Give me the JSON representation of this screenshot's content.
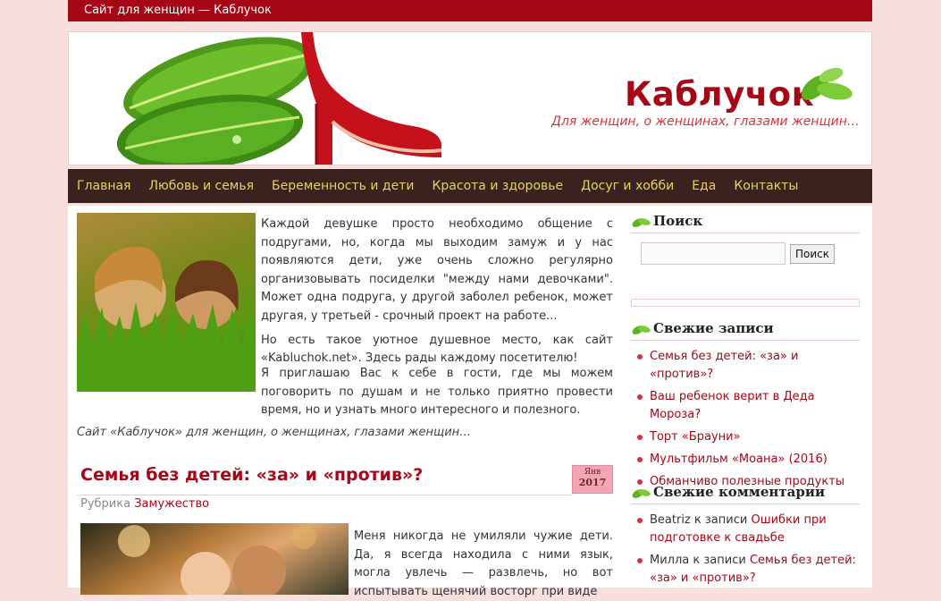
{
  "topbar": {
    "title": "Сайт для женщин — Каблучок"
  },
  "header": {
    "site_title": "Каблучок",
    "tagline": "Для женщин, о женщинах, глазами женщин…"
  },
  "nav": {
    "items": [
      "Главная",
      "Любовь и семья",
      "Беременность и дети",
      "Красота и здоровье",
      "Досуг и хобби",
      "Еда",
      "Контакты"
    ]
  },
  "intro": {
    "p1": "Каждой девушке просто необходимо общение с подругами, но, когда мы выходим замуж и у нас появляются дети, уже очень сложно регулярно организовывать посиделки \"между нами девочками\". Может одна подруга, у другой заболел ребенок, может другая, у третьей - срочный проект на работе...",
    "p2": "Но есть такое уютное душевное место, как сайт «Kabluchok.net». Здесь рады каждому посетителю!",
    "p3": "Я приглашаю Вас к себе в гости, где мы можем поговорить по душам и не только приятно провести время, но и узнать много интересного и полезного.",
    "signature": "Сайт «Каблучок» для женщин, о женщинах, глазами женщин…"
  },
  "post": {
    "title": "Семья без детей: «за» и «против»?",
    "date_month": "Янв",
    "date_year": "2017",
    "category_label": "Рубрика",
    "category": "Замужество",
    "excerpt": "Меня никогда не умиляли чужие дети. Да, я всегда находила с ними язык, могла увлечь — развлечь, но вот испытывать щенячий восторг при виде"
  },
  "sidebar": {
    "search": {
      "title": "Поиск",
      "button": "Поиск",
      "value": ""
    },
    "recent_posts": {
      "title": "Свежие записи",
      "items": [
        "Семья без детей: «за» и «против»?",
        "Ваш ребенок верит в Деда Мороза?",
        "Торт «Брауни»",
        "Мультфильм «Моана» (2016)",
        "Обманчиво полезные продукты"
      ]
    },
    "recent_comments": {
      "title": "Свежие комментарии",
      "items": [
        {
          "author": "Beatriz",
          "connector": "к записи",
          "post": "Ошибки при подготовке к свадьбе"
        },
        {
          "author": "Милла",
          "connector": "к записи",
          "post": "Семья без детей: «за» и «против»?"
        }
      ]
    }
  },
  "colors": {
    "accent": "#a60717",
    "nav_bg": "#3a221e",
    "nav_text": "#e8d15c",
    "page_bg": "#f9dede"
  }
}
